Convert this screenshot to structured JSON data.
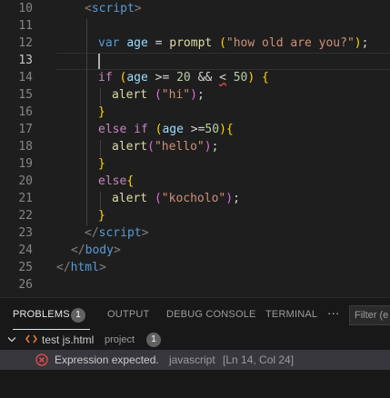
{
  "editor": {
    "line_numbers": [
      "10",
      "11",
      "12",
      "13",
      "14",
      "15",
      "16",
      "17",
      "18",
      "19",
      "20",
      "21",
      "22",
      "23",
      "24",
      "25",
      "26"
    ],
    "code": {
      "l10_tag": "script",
      "l12_kw": "var",
      "l12_var": "age",
      "l12_op": " = ",
      "l12_fn": "prompt",
      "l12_sp": " ",
      "l12_str": "\"how old are you?\"",
      "l12_semi": ";",
      "l14_kw": "if",
      "l14_var": "age",
      "l14_op1": " >= ",
      "l14_num1": "20",
      "l14_op2": " && ",
      "l14_err": "<",
      "l14_sp": " ",
      "l14_num2": "50",
      "l15_fn": "alert",
      "l15_str": "\"hi\"",
      "l15_semi": ";",
      "l17_kw": "else if",
      "l17_var": "age",
      "l17_op": " >=",
      "l17_num": "50",
      "l18_fn": "alert",
      "l18_str": "\"hello\"",
      "l18_semi": ";",
      "l20_kw": "else",
      "l21_fn": "alert",
      "l21_str": "\"kocholo\"",
      "l21_semi": ";",
      "l23_tag": "script",
      "l24_tag": "body",
      "l25_tag": "html"
    }
  },
  "panel": {
    "tabs": [
      {
        "label": "PROBLEMS",
        "badge": "1"
      },
      {
        "label": "OUTPUT"
      },
      {
        "label": "DEBUG CONSOLE"
      },
      {
        "label": "TERMINAL"
      }
    ],
    "more_label": "···",
    "filter_placeholder": "Filter (e",
    "file": {
      "name": "test js.html",
      "folder": "project",
      "count": "1"
    },
    "problem": {
      "message": "Expression expected.",
      "source": "javascript",
      "location": "[Ln 14, Col 24]"
    }
  }
}
